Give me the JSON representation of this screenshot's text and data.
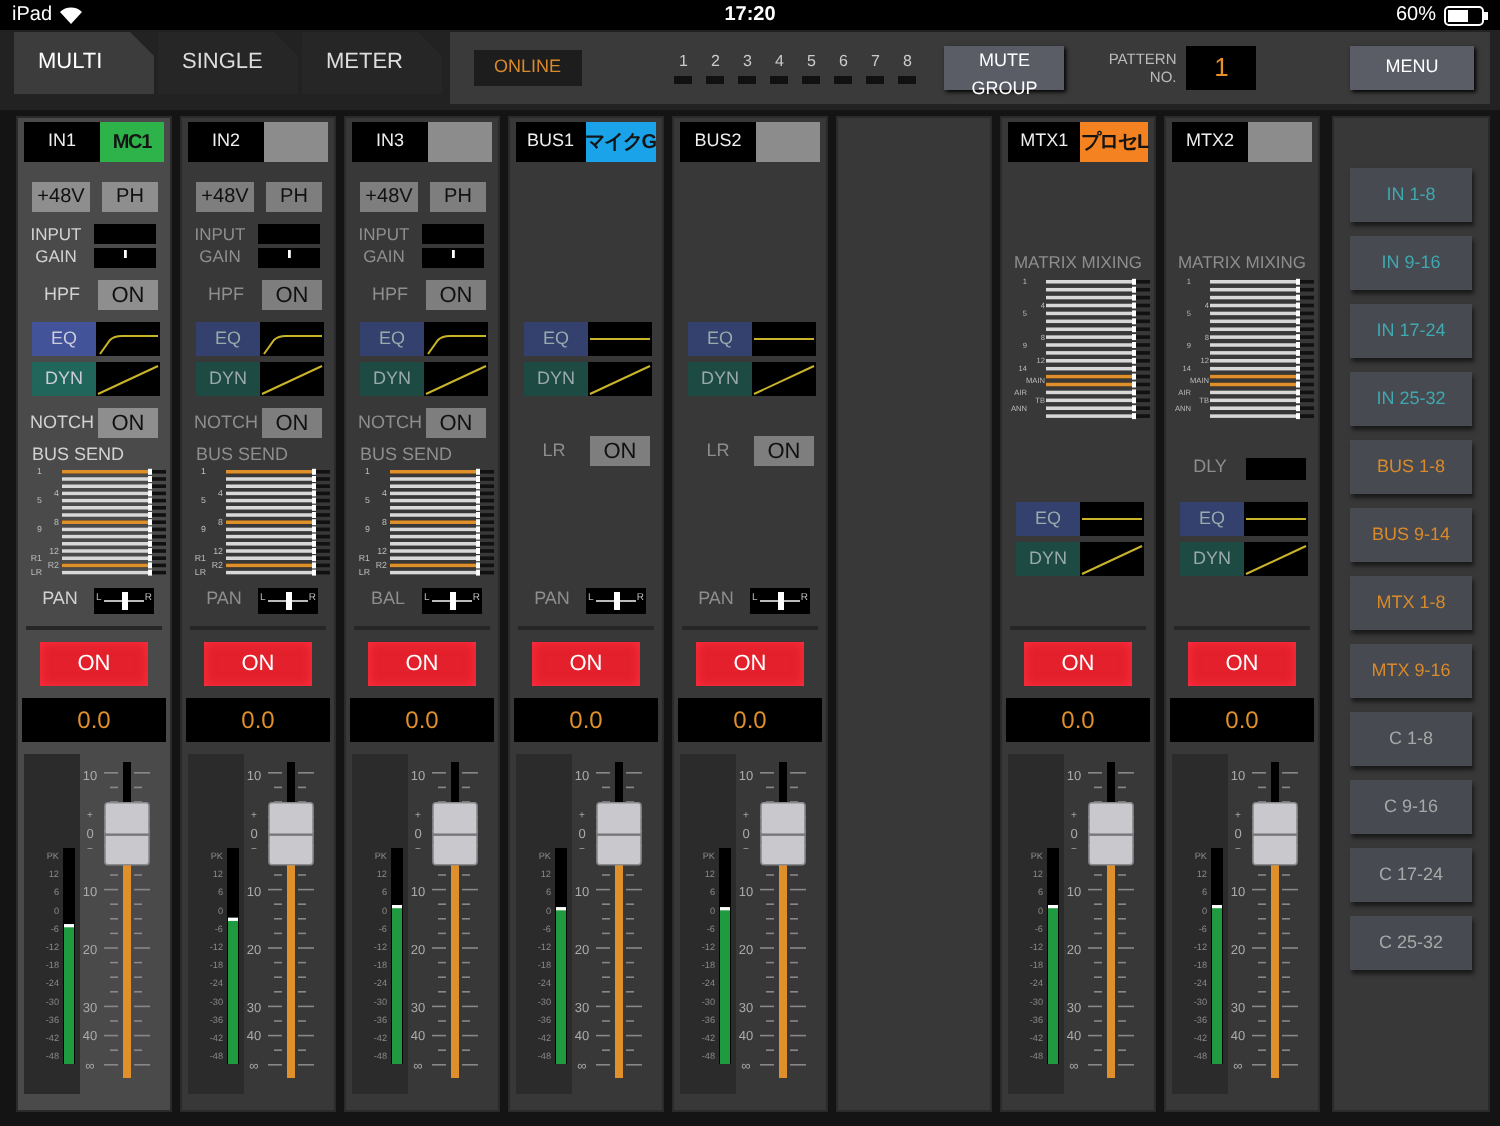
{
  "status_bar": {
    "device": "iPad",
    "time": "17:20",
    "battery": "60%"
  },
  "tabs": [
    {
      "label": "MULTI",
      "selected": true
    },
    {
      "label": "SINGLE",
      "selected": false
    },
    {
      "label": "METER",
      "selected": false
    }
  ],
  "connection": "ONLINE",
  "mute_groups": [
    {
      "label": "1",
      "on": false
    },
    {
      "label": "2",
      "on": false
    },
    {
      "label": "3",
      "on": false
    },
    {
      "label": "4",
      "on": false
    },
    {
      "label": "5",
      "on": false
    },
    {
      "label": "6",
      "on": false
    },
    {
      "label": "7",
      "on": false
    },
    {
      "label": "8",
      "on": false
    }
  ],
  "mute_group_button": "MUTE GROUP",
  "pattern": {
    "label": "PATTERN NO.",
    "value": "1"
  },
  "menu_button": "MENU",
  "channels": [
    {
      "kind": "input",
      "id": "IN1",
      "name": "MC1",
      "color": "#2db34a",
      "selected": true,
      "phantom": {
        "label": "+48V",
        "on": false
      },
      "phase": {
        "label": "PH",
        "on": false
      },
      "gain_label": "INPUT GAIN",
      "hpf": {
        "label": "HPF",
        "button": "ON",
        "on": false
      },
      "eq": "EQ",
      "dyn": "DYN",
      "notch": {
        "label": "NOTCH",
        "button": "ON",
        "on": false
      },
      "send_title": "BUS SEND",
      "send_labels": [
        "1",
        "4",
        "5",
        "8",
        "9",
        "12",
        "R1",
        "R2",
        "LR"
      ],
      "pan": {
        "label": "PAN",
        "left": "L",
        "right": "R",
        "level": 0.5
      },
      "on": {
        "label": "ON",
        "on": true
      },
      "value": "0.0",
      "meter": {
        "level": 0.66,
        "scale": [
          "PK",
          "12",
          "6",
          "0",
          "-6",
          "-12",
          "-18",
          "-24",
          "-30",
          "-36",
          "-42",
          "-48"
        ]
      },
      "fader": {
        "level": 0.77,
        "scale": [
          "10",
          "+",
          "0",
          "−",
          "10",
          "20",
          "30",
          "40",
          "∞"
        ]
      }
    },
    {
      "kind": "input",
      "id": "IN2",
      "color": "#8c8c8c",
      "selected": false,
      "phantom": {
        "label": "+48V",
        "on": false
      },
      "phase": {
        "label": "PH",
        "on": false
      },
      "gain_label": "INPUT GAIN",
      "hpf": {
        "label": "HPF",
        "button": "ON",
        "on": false
      },
      "eq": "EQ",
      "dyn": "DYN",
      "notch": {
        "label": "NOTCH",
        "button": "ON",
        "on": false
      },
      "send_title": "BUS SEND",
      "send_labels": [
        "1",
        "4",
        "5",
        "8",
        "9",
        "12",
        "R1",
        "R2",
        "LR"
      ],
      "pan": {
        "label": "PAN",
        "left": "L",
        "right": "R",
        "level": 0.5
      },
      "on": {
        "label": "ON",
        "on": true
      },
      "value": "0.0",
      "meter": {
        "level": 0.69,
        "scale": [
          "PK",
          "12",
          "6",
          "0",
          "-6",
          "-12",
          "-18",
          "-24",
          "-30",
          "-36",
          "-42",
          "-48"
        ]
      },
      "fader": {
        "level": 0.77,
        "scale": [
          "10",
          "+",
          "0",
          "−",
          "10",
          "20",
          "30",
          "40",
          "∞"
        ]
      }
    },
    {
      "kind": "input",
      "id": "IN3",
      "color": "#8c8c8c",
      "selected": false,
      "phantom": {
        "label": "+48V",
        "on": false
      },
      "phase": {
        "label": "PH",
        "on": false
      },
      "gain_label": "INPUT GAIN",
      "hpf": {
        "label": "HPF",
        "button": "ON",
        "on": false
      },
      "eq": "EQ",
      "dyn": "DYN",
      "notch": {
        "label": "NOTCH",
        "button": "ON",
        "on": false
      },
      "send_title": "BUS SEND",
      "send_labels": [
        "1",
        "4",
        "5",
        "8",
        "9",
        "12",
        "R1",
        "R2",
        "LR"
      ],
      "pan": {
        "label": "BAL",
        "left": "L",
        "right": "R",
        "level": 0.5
      },
      "on": {
        "label": "ON",
        "on": true
      },
      "value": "0.0",
      "meter": {
        "level": 0.75,
        "scale": [
          "PK",
          "12",
          "6",
          "0",
          "-6",
          "-12",
          "-18",
          "-24",
          "-30",
          "-36",
          "-42",
          "-48"
        ]
      },
      "fader": {
        "level": 0.77,
        "scale": [
          "10",
          "+",
          "0",
          "−",
          "10",
          "20",
          "30",
          "40",
          "∞"
        ]
      }
    },
    {
      "kind": "bus",
      "id": "BUS1",
      "name": "マイクG",
      "color": "#1aa3e8",
      "selected": false,
      "eq": "EQ",
      "dyn": "DYN",
      "lr": {
        "label": "LR",
        "button": "ON",
        "on": false
      },
      "pan": {
        "label": "PAN",
        "left": "L",
        "right": "R",
        "level": 0.5
      },
      "on": {
        "label": "ON",
        "on": true
      },
      "value": "0.0",
      "meter": {
        "level": 0.74,
        "scale": [
          "PK",
          "12",
          "6",
          "0",
          "-6",
          "-12",
          "-18",
          "-24",
          "-30",
          "-36",
          "-42",
          "-48"
        ]
      },
      "fader": {
        "level": 0.77,
        "scale": [
          "10",
          "+",
          "0",
          "−",
          "10",
          "20",
          "30",
          "40",
          "∞"
        ]
      }
    },
    {
      "kind": "bus",
      "id": "BUS2",
      "color": "#8c8c8c",
      "selected": false,
      "eq": "EQ",
      "dyn": "DYN",
      "lr": {
        "label": "LR",
        "button": "ON",
        "on": false
      },
      "pan": {
        "label": "PAN",
        "left": "L",
        "right": "R",
        "level": 0.5
      },
      "on": {
        "label": "ON",
        "on": true
      },
      "value": "0.0",
      "meter": {
        "level": 0.74,
        "scale": [
          "PK",
          "12",
          "6",
          "0",
          "-6",
          "-12",
          "-18",
          "-24",
          "-30",
          "-36",
          "-42",
          "-48"
        ]
      },
      "fader": {
        "level": 0.77,
        "scale": [
          "10",
          "+",
          "0",
          "−",
          "10",
          "20",
          "30",
          "40",
          "∞"
        ]
      }
    },
    {
      "kind": "empty"
    },
    {
      "kind": "matrix",
      "id": "MTX1",
      "name": "プロセL",
      "color": "#f58220",
      "selected": false,
      "mix_title": "MATRIX MIXING",
      "mix_labels": [
        "1",
        "4",
        "5",
        "8",
        "9",
        "12",
        "14",
        "MAIN",
        "AIR",
        "TB",
        "ANN"
      ],
      "eq": "EQ",
      "dyn": "DYN",
      "on": {
        "label": "ON",
        "on": true
      },
      "value": "0.0",
      "meter": {
        "level": 0.75,
        "scale": [
          "PK",
          "12",
          "6",
          "0",
          "-6",
          "-12",
          "-18",
          "-24",
          "-30",
          "-36",
          "-42",
          "-48"
        ]
      },
      "fader": {
        "level": 0.77,
        "scale": [
          "10",
          "+",
          "0",
          "−",
          "10",
          "20",
          "30",
          "40",
          "∞"
        ]
      }
    },
    {
      "kind": "matrix",
      "id": "MTX2",
      "color": "#8c8c8c",
      "selected": false,
      "mix_title": "MATRIX MIXING",
      "mix_labels": [
        "1",
        "4",
        "5",
        "8",
        "9",
        "12",
        "14",
        "MAIN",
        "AIR",
        "TB",
        "ANN"
      ],
      "dly": "DLY",
      "eq": "EQ",
      "dyn": "DYN",
      "on": {
        "label": "ON",
        "on": true
      },
      "value": "0.0",
      "meter": {
        "level": 0.75,
        "scale": [
          "PK",
          "12",
          "6",
          "0",
          "-6",
          "-12",
          "-18",
          "-24",
          "-30",
          "-36",
          "-42",
          "-48"
        ]
      },
      "fader": {
        "level": 0.77,
        "scale": [
          "10",
          "+",
          "0",
          "−",
          "10",
          "20",
          "30",
          "40",
          "∞"
        ]
      }
    }
  ],
  "sidebar": [
    {
      "label": "IN 1-8",
      "color": "#3fa8b0"
    },
    {
      "label": "IN 9-16",
      "color": "#3fa8b0"
    },
    {
      "label": "IN 17-24",
      "color": "#3fa8b0"
    },
    {
      "label": "IN 25-32",
      "color": "#3fa8b0"
    },
    {
      "label": "BUS 1-8",
      "color": "#d98a2a"
    },
    {
      "label": "BUS 9-14",
      "color": "#d98a2a"
    },
    {
      "label": "MTX 1-8",
      "color": "#d98a2a"
    },
    {
      "label": "MTX 9-16",
      "color": "#d98a2a"
    },
    {
      "label": "C 1-8",
      "color": "#a8a8a8"
    },
    {
      "label": "C 9-16",
      "color": "#a8a8a8"
    },
    {
      "label": "C 17-24",
      "color": "#a8a8a8"
    },
    {
      "label": "C 25-32",
      "color": "#a8a8a8"
    }
  ]
}
